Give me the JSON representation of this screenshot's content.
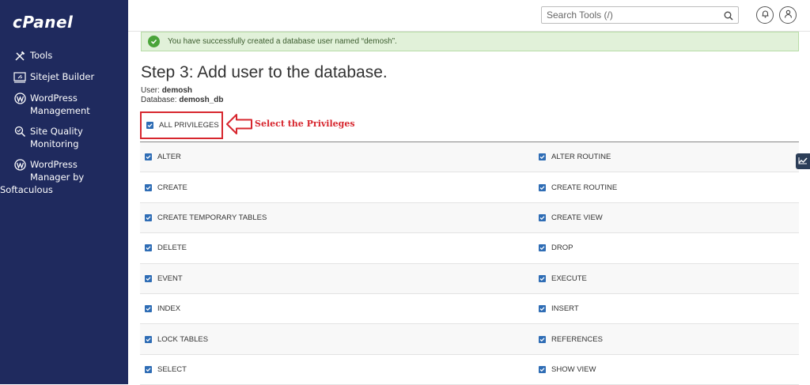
{
  "brand": {
    "logo_text": "cPanel"
  },
  "sidebar": {
    "items": [
      {
        "icon": "tools-icon",
        "lines": [
          "Tools"
        ]
      },
      {
        "icon": "sitejet-icon",
        "lines": [
          "Sitejet Builder"
        ]
      },
      {
        "icon": "wordpress-icon",
        "lines": [
          "WordPress",
          "Management"
        ]
      },
      {
        "icon": "site-quality-icon",
        "lines": [
          "Site Quality",
          "Monitoring"
        ]
      },
      {
        "icon": "wordpress-icon",
        "lines": [
          "WordPress",
          "Manager by",
          "Softaculous"
        ]
      }
    ]
  },
  "header": {
    "search_placeholder": "Search Tools (/)"
  },
  "alert": {
    "message": "You have successfully created a database user named “demosh”."
  },
  "page": {
    "title": "Step 3: Add user to the database.",
    "user_label": "User:",
    "user_value": "demosh",
    "database_label": "Database:",
    "database_value": "demosh_db"
  },
  "all_privileges": {
    "label": "ALL PRIVILEGES",
    "checked": true
  },
  "annotation": {
    "text": "Select the Privileges",
    "color": "#d7262e"
  },
  "privileges": {
    "rows": [
      {
        "left": "ALTER",
        "right": "ALTER ROUTINE"
      },
      {
        "left": "CREATE",
        "right": "CREATE ROUTINE"
      },
      {
        "left": "CREATE TEMPORARY TABLES",
        "right": "CREATE VIEW"
      },
      {
        "left": "DELETE",
        "right": "DROP"
      },
      {
        "left": "EVENT",
        "right": "EXECUTE"
      },
      {
        "left": "INDEX",
        "right": "INSERT"
      },
      {
        "left": "LOCK TABLES",
        "right": "REFERENCES"
      },
      {
        "left": "SELECT",
        "right": "SHOW VIEW"
      }
    ]
  },
  "colors": {
    "sidebar_bg": "#1f2a5e",
    "checkbox": "#2f6db5",
    "success_bg": "#e1f1d9"
  }
}
